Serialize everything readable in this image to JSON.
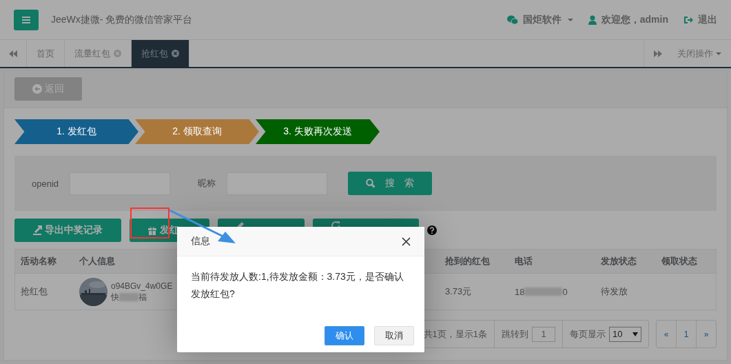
{
  "header": {
    "brand": "JeeWx捷微- 免费的微信管家平台",
    "nav": [
      {
        "label": "国炬软件",
        "kind": "wechat"
      },
      {
        "label": "欢迎您，admin",
        "kind": "user"
      },
      {
        "label": "退出",
        "kind": "logout"
      }
    ]
  },
  "tabs": [
    {
      "label": "首页",
      "selected": false,
      "closable": false
    },
    {
      "label": "流量红包",
      "selected": false,
      "closable": true
    },
    {
      "label": "抢红包",
      "selected": true,
      "closable": true
    }
  ],
  "close_menu": "关闭操作",
  "back_button": "返回",
  "steps": [
    {
      "label": "1. 发红包",
      "color": "#155f8c"
    },
    {
      "label": "2. 领取查询",
      "color": "#ab783c"
    },
    {
      "label": "3. 失败再次发送",
      "color": "#006000"
    }
  ],
  "search": {
    "fields": [
      {
        "label": "openid"
      },
      {
        "label": "昵称"
      }
    ],
    "button": "搜 索"
  },
  "actions": [
    {
      "label": "导出中奖记录",
      "kind": "export"
    },
    {
      "label": "发红",
      "kind": "gift"
    },
    {
      "kind": "edit"
    },
    {
      "kind": "refresh"
    }
  ],
  "table": {
    "columns": [
      "活动名称",
      "个人信息",
      "抢到的红包",
      "电话",
      "发放状态",
      "领取状态"
    ],
    "rows": [
      {
        "activity": "抢红包",
        "openid": "o94BGv_4w0GE",
        "nickname": "快",
        "nickname_end": "福",
        "amount": "3.73元",
        "phone_start": "18",
        "phone_end": "0",
        "send_status": "待发放"
      }
    ]
  },
  "pagination": {
    "summary": "共1页，显示1条",
    "jump_label": "跳转到",
    "jump_value": "1",
    "page_size_label": "每页显示",
    "page_size": "10",
    "pages": [
      "«",
      "1",
      "»"
    ]
  },
  "dialog": {
    "title": "信息",
    "message": "当前待发放人数:1,待发放金额：3.73元，是否确认发放红包?",
    "buttons": [
      {
        "label": "确认",
        "kind": "primary"
      },
      {
        "label": "取消",
        "kind": "default"
      }
    ]
  }
}
